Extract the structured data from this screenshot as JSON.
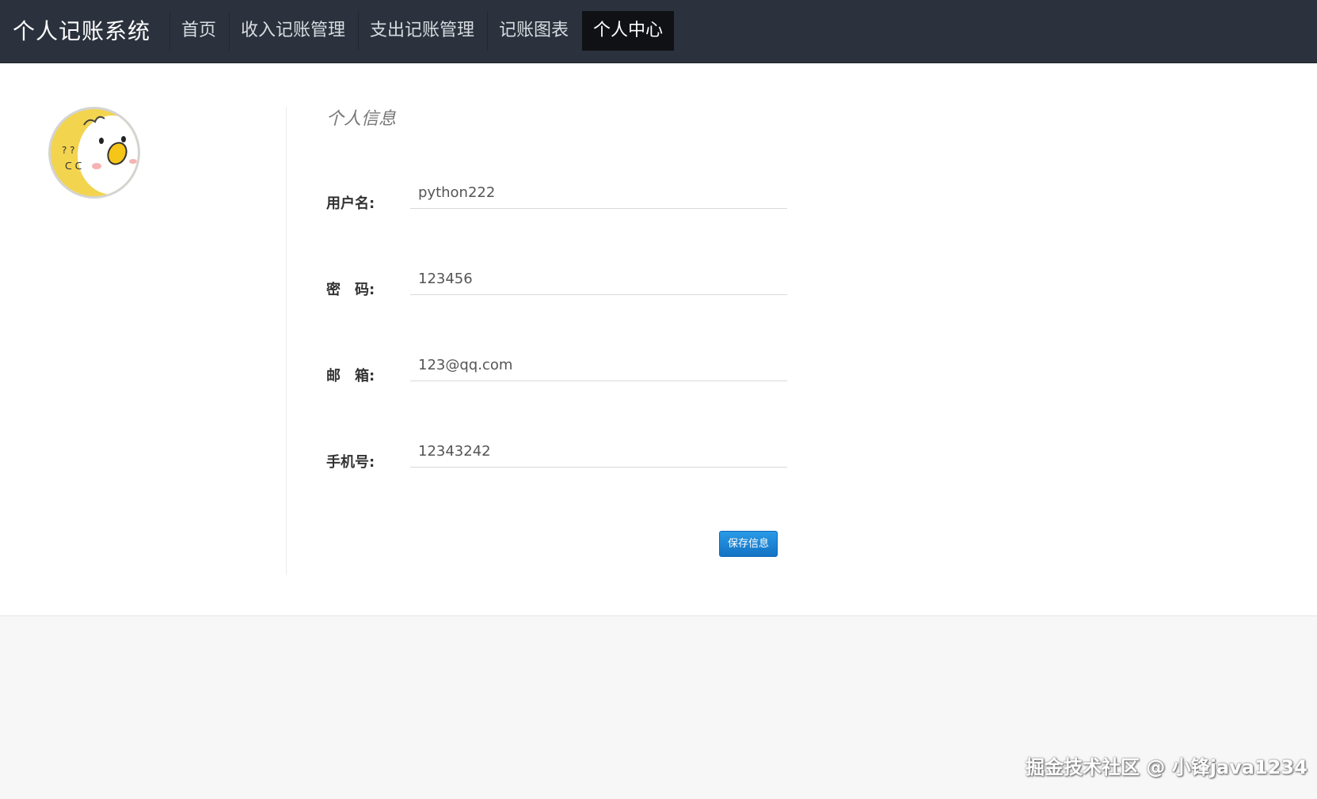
{
  "app": {
    "title": "个人记账系统"
  },
  "nav": {
    "items": [
      {
        "label": "首页"
      },
      {
        "label": "收入记账管理"
      },
      {
        "label": "支出记账管理"
      },
      {
        "label": "记账图表"
      },
      {
        "label": "个人中心"
      }
    ],
    "active": "个人中心"
  },
  "profile": {
    "section_title": "个人信息",
    "fields": [
      {
        "label": "用户名:",
        "value": "python222"
      },
      {
        "label": "密　码:",
        "value": "123456"
      },
      {
        "label": "邮　箱:",
        "value": "123@qq.com"
      },
      {
        "label": "手机号:",
        "value": "12343242"
      }
    ],
    "save_label": "保存信息",
    "avatar_icon": "duck-avatar-icon"
  },
  "watermark": "掘金技术社区 @ 小锋java1234",
  "colors": {
    "navbar": "#2b323d",
    "nav_active": "#0f1114",
    "button": "#1a84d6",
    "avatar_bg": "#f3d44f"
  }
}
